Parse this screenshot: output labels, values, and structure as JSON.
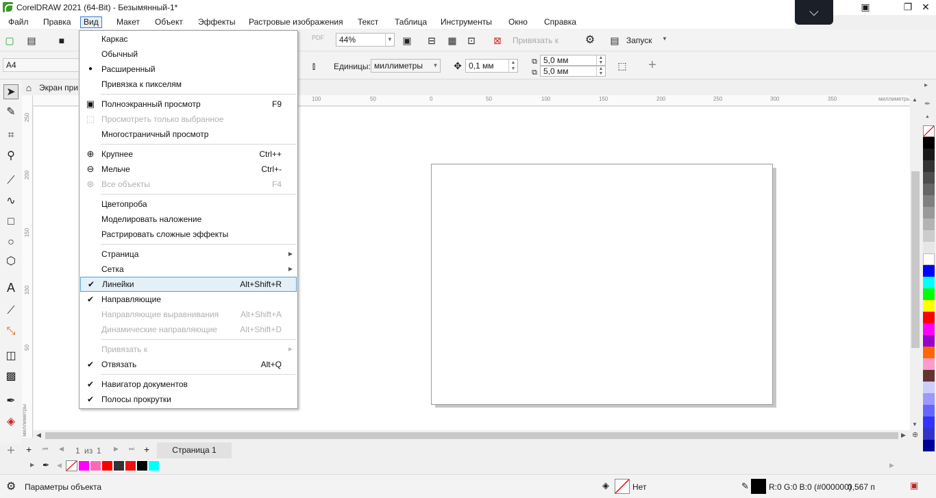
{
  "window": {
    "title": "CorelDRAW 2021 (64-Bit) - Безымянный-1*",
    "collapse_glyph": "⌵",
    "controls": {
      "restore_down": "❐",
      "close": "✕",
      "help": "▣"
    }
  },
  "menubar": {
    "items": [
      {
        "key": "file",
        "label": "Файл"
      },
      {
        "key": "edit",
        "label": "Правка"
      },
      {
        "key": "view",
        "label": "Вид"
      },
      {
        "key": "layout",
        "label": "Макет"
      },
      {
        "key": "object",
        "label": "Объект"
      },
      {
        "key": "effects",
        "label": "Эффекты"
      },
      {
        "key": "bitmaps",
        "label": "Растровые изображения"
      },
      {
        "key": "text",
        "label": "Текст"
      },
      {
        "key": "table",
        "label": "Таблица"
      },
      {
        "key": "tools",
        "label": "Инструменты"
      },
      {
        "key": "window",
        "label": "Окно"
      },
      {
        "key": "help",
        "label": "Справка"
      }
    ]
  },
  "toolbar": {
    "zoom_value": "44%",
    "snap_to_label": "Привязать к",
    "launch_label": "Запуск",
    "pdf_label": "PDF"
  },
  "property_bar": {
    "page_size": "A4",
    "units_label": "Единицы:",
    "units_value": "миллиметры",
    "nudge_value": "0,1 мм",
    "dup_x": "5,0 мм",
    "dup_y": "5,0 мм",
    "add_glyph": "+"
  },
  "doc_tabs": {
    "welcome_label": "Экран при"
  },
  "ruler": {
    "unit_label": "миллиметры",
    "top_ticks": [
      "100",
      "50",
      "0",
      "50",
      "100",
      "150",
      "200",
      "250",
      "300",
      "350"
    ],
    "left_ticks": [
      "250",
      "200",
      "150",
      "100",
      "50"
    ]
  },
  "page_nav": {
    "current": "1",
    "of_label": "из",
    "total": "1",
    "page_tab": "Страница 1"
  },
  "status": {
    "object_params": "Параметры объекта",
    "fill_none": "Нет",
    "color_info": "R:0 G:0 B:0 (#000000)",
    "outline_width": "0,567 п"
  },
  "view_menu": {
    "items": [
      {
        "label": "Каркас",
        "mark": "",
        "shortcut": ""
      },
      {
        "label": "Обычный",
        "mark": "",
        "shortcut": ""
      },
      {
        "label": "Расширенный",
        "mark": "●",
        "shortcut": ""
      },
      {
        "label": "Привязка к пикселям",
        "mark": "",
        "shortcut": ""
      },
      {
        "label": "Полноэкранный просмотр",
        "mark": "",
        "shortcut": "F9"
      },
      {
        "label": "Просмотреть только выбранное",
        "mark": "",
        "shortcut": ""
      },
      {
        "label": "Многостраничный просмотр",
        "mark": "",
        "shortcut": ""
      },
      {
        "label": "Крупнее",
        "mark": "",
        "shortcut": "Ctrl++"
      },
      {
        "label": "Мельче",
        "mark": "",
        "shortcut": "Ctrl+-"
      },
      {
        "label": "Все объекты",
        "mark": "",
        "shortcut": "F4"
      },
      {
        "label": "Цветопроба",
        "mark": "",
        "shortcut": ""
      },
      {
        "label": "Моделировать наложение",
        "mark": "",
        "shortcut": ""
      },
      {
        "label": "Растрировать сложные эффекты",
        "mark": "",
        "shortcut": ""
      },
      {
        "label": "Страница",
        "mark": "",
        "shortcut": ""
      },
      {
        "label": "Сетка",
        "mark": "",
        "shortcut": ""
      },
      {
        "label": "Линейки",
        "mark": "✔",
        "shortcut": "Alt+Shift+R"
      },
      {
        "label": "Направляющие",
        "mark": "✔",
        "shortcut": ""
      },
      {
        "label": "Направляющие выравнивания",
        "mark": "",
        "shortcut": "Alt+Shift+A"
      },
      {
        "label": "Динамические направляющие",
        "mark": "",
        "shortcut": "Alt+Shift+D"
      },
      {
        "label": "Привязать к",
        "mark": "",
        "shortcut": ""
      },
      {
        "label": "Отвязать",
        "mark": "✔",
        "shortcut": "Alt+Q"
      },
      {
        "label": "Навигатор документов",
        "mark": "✔",
        "shortcut": ""
      },
      {
        "label": "Полосы прокрутки",
        "mark": "✔",
        "shortcut": ""
      }
    ]
  },
  "colors": {
    "menu_highlight": "#e3eff9",
    "highlight_border": "#4aa3d6",
    "doc_palette": [
      "#ff00ff",
      "#ff69b4",
      "#ff0000",
      "#333333",
      "#ee1111",
      "#000000",
      "#00ffff"
    ],
    "main_palette": [
      "#000000",
      "#1a1a1a",
      "#333333",
      "#4d4d4d",
      "#666666",
      "#808080",
      "#999999",
      "#b3b3b3",
      "#cccccc",
      "#e6e6e6",
      "#ffffff",
      "#0000ff",
      "#00ffff",
      "#00ff00",
      "#ffff00",
      "#ff0000",
      "#ff00ff",
      "#9900cc",
      "#ff6600",
      "#ff99cc",
      "#663333",
      "#ccccff",
      "#9999ff",
      "#6666ff",
      "#3333ff",
      "#3333cc",
      "#000099"
    ]
  }
}
